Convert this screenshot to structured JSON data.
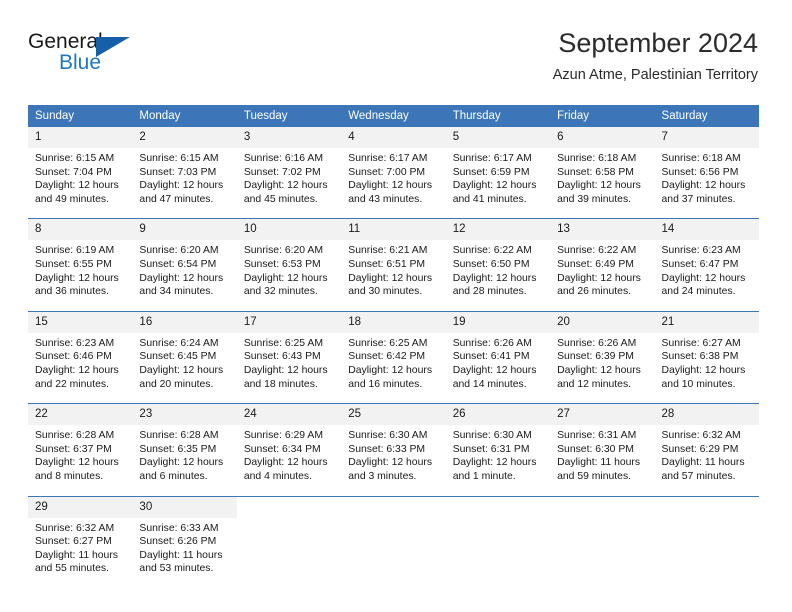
{
  "brand": {
    "name_top": "General",
    "name_bottom": "Blue",
    "accent_color": "#1560a8",
    "blue_text_color": "#1e79c3"
  },
  "header": {
    "title": "September 2024",
    "subtitle": "Azun Atme, Palestinian Territory"
  },
  "calendar": {
    "header_color": "#3c76b8",
    "daynum_bg": "#f2f2f2",
    "weekdays": [
      "Sunday",
      "Monday",
      "Tuesday",
      "Wednesday",
      "Thursday",
      "Friday",
      "Saturday"
    ],
    "weeks": [
      [
        {
          "day": "1",
          "sunrise": "Sunrise: 6:15 AM",
          "sunset": "Sunset: 7:04 PM",
          "daylight": "Daylight: 12 hours and 49 minutes."
        },
        {
          "day": "2",
          "sunrise": "Sunrise: 6:15 AM",
          "sunset": "Sunset: 7:03 PM",
          "daylight": "Daylight: 12 hours and 47 minutes."
        },
        {
          "day": "3",
          "sunrise": "Sunrise: 6:16 AM",
          "sunset": "Sunset: 7:02 PM",
          "daylight": "Daylight: 12 hours and 45 minutes."
        },
        {
          "day": "4",
          "sunrise": "Sunrise: 6:17 AM",
          "sunset": "Sunset: 7:00 PM",
          "daylight": "Daylight: 12 hours and 43 minutes."
        },
        {
          "day": "5",
          "sunrise": "Sunrise: 6:17 AM",
          "sunset": "Sunset: 6:59 PM",
          "daylight": "Daylight: 12 hours and 41 minutes."
        },
        {
          "day": "6",
          "sunrise": "Sunrise: 6:18 AM",
          "sunset": "Sunset: 6:58 PM",
          "daylight": "Daylight: 12 hours and 39 minutes."
        },
        {
          "day": "7",
          "sunrise": "Sunrise: 6:18 AM",
          "sunset": "Sunset: 6:56 PM",
          "daylight": "Daylight: 12 hours and 37 minutes."
        }
      ],
      [
        {
          "day": "8",
          "sunrise": "Sunrise: 6:19 AM",
          "sunset": "Sunset: 6:55 PM",
          "daylight": "Daylight: 12 hours and 36 minutes."
        },
        {
          "day": "9",
          "sunrise": "Sunrise: 6:20 AM",
          "sunset": "Sunset: 6:54 PM",
          "daylight": "Daylight: 12 hours and 34 minutes."
        },
        {
          "day": "10",
          "sunrise": "Sunrise: 6:20 AM",
          "sunset": "Sunset: 6:53 PM",
          "daylight": "Daylight: 12 hours and 32 minutes."
        },
        {
          "day": "11",
          "sunrise": "Sunrise: 6:21 AM",
          "sunset": "Sunset: 6:51 PM",
          "daylight": "Daylight: 12 hours and 30 minutes."
        },
        {
          "day": "12",
          "sunrise": "Sunrise: 6:22 AM",
          "sunset": "Sunset: 6:50 PM",
          "daylight": "Daylight: 12 hours and 28 minutes."
        },
        {
          "day": "13",
          "sunrise": "Sunrise: 6:22 AM",
          "sunset": "Sunset: 6:49 PM",
          "daylight": "Daylight: 12 hours and 26 minutes."
        },
        {
          "day": "14",
          "sunrise": "Sunrise: 6:23 AM",
          "sunset": "Sunset: 6:47 PM",
          "daylight": "Daylight: 12 hours and 24 minutes."
        }
      ],
      [
        {
          "day": "15",
          "sunrise": "Sunrise: 6:23 AM",
          "sunset": "Sunset: 6:46 PM",
          "daylight": "Daylight: 12 hours and 22 minutes."
        },
        {
          "day": "16",
          "sunrise": "Sunrise: 6:24 AM",
          "sunset": "Sunset: 6:45 PM",
          "daylight": "Daylight: 12 hours and 20 minutes."
        },
        {
          "day": "17",
          "sunrise": "Sunrise: 6:25 AM",
          "sunset": "Sunset: 6:43 PM",
          "daylight": "Daylight: 12 hours and 18 minutes."
        },
        {
          "day": "18",
          "sunrise": "Sunrise: 6:25 AM",
          "sunset": "Sunset: 6:42 PM",
          "daylight": "Daylight: 12 hours and 16 minutes."
        },
        {
          "day": "19",
          "sunrise": "Sunrise: 6:26 AM",
          "sunset": "Sunset: 6:41 PM",
          "daylight": "Daylight: 12 hours and 14 minutes."
        },
        {
          "day": "20",
          "sunrise": "Sunrise: 6:26 AM",
          "sunset": "Sunset: 6:39 PM",
          "daylight": "Daylight: 12 hours and 12 minutes."
        },
        {
          "day": "21",
          "sunrise": "Sunrise: 6:27 AM",
          "sunset": "Sunset: 6:38 PM",
          "daylight": "Daylight: 12 hours and 10 minutes."
        }
      ],
      [
        {
          "day": "22",
          "sunrise": "Sunrise: 6:28 AM",
          "sunset": "Sunset: 6:37 PM",
          "daylight": "Daylight: 12 hours and 8 minutes."
        },
        {
          "day": "23",
          "sunrise": "Sunrise: 6:28 AM",
          "sunset": "Sunset: 6:35 PM",
          "daylight": "Daylight: 12 hours and 6 minutes."
        },
        {
          "day": "24",
          "sunrise": "Sunrise: 6:29 AM",
          "sunset": "Sunset: 6:34 PM",
          "daylight": "Daylight: 12 hours and 4 minutes."
        },
        {
          "day": "25",
          "sunrise": "Sunrise: 6:30 AM",
          "sunset": "Sunset: 6:33 PM",
          "daylight": "Daylight: 12 hours and 3 minutes."
        },
        {
          "day": "26",
          "sunrise": "Sunrise: 6:30 AM",
          "sunset": "Sunset: 6:31 PM",
          "daylight": "Daylight: 12 hours and 1 minute."
        },
        {
          "day": "27",
          "sunrise": "Sunrise: 6:31 AM",
          "sunset": "Sunset: 6:30 PM",
          "daylight": "Daylight: 11 hours and 59 minutes."
        },
        {
          "day": "28",
          "sunrise": "Sunrise: 6:32 AM",
          "sunset": "Sunset: 6:29 PM",
          "daylight": "Daylight: 11 hours and 57 minutes."
        }
      ],
      [
        {
          "day": "29",
          "sunrise": "Sunrise: 6:32 AM",
          "sunset": "Sunset: 6:27 PM",
          "daylight": "Daylight: 11 hours and 55 minutes."
        },
        {
          "day": "30",
          "sunrise": "Sunrise: 6:33 AM",
          "sunset": "Sunset: 6:26 PM",
          "daylight": "Daylight: 11 hours and 53 minutes."
        },
        {
          "day": "",
          "sunrise": "",
          "sunset": "",
          "daylight": ""
        },
        {
          "day": "",
          "sunrise": "",
          "sunset": "",
          "daylight": ""
        },
        {
          "day": "",
          "sunrise": "",
          "sunset": "",
          "daylight": ""
        },
        {
          "day": "",
          "sunrise": "",
          "sunset": "",
          "daylight": ""
        },
        {
          "day": "",
          "sunrise": "",
          "sunset": "",
          "daylight": ""
        }
      ]
    ]
  }
}
